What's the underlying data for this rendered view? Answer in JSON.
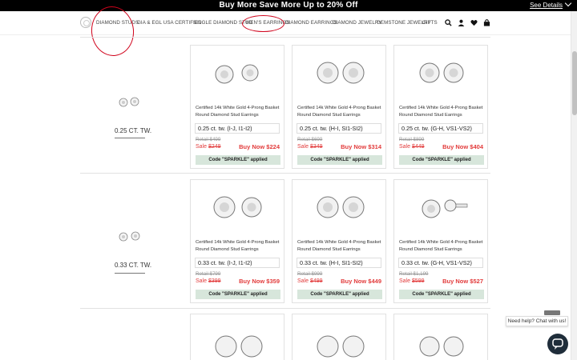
{
  "promo": {
    "text": "Buy More Save More Up to 20% Off",
    "details_label": "See Details"
  },
  "nav": {
    "items": [
      "DIAMOND STUDS",
      "GIA & EGL USA CERTIFIED",
      "SINGLE DIAMOND STUD",
      "MEN'S EARRINGS",
      "DIAMOND EARRINGS",
      "DIAMOND JEWELRY",
      "GEMSTONE JEWELRY",
      "GIFTS"
    ],
    "icons": [
      "search-icon",
      "account-icon",
      "heart-icon",
      "bag-icon"
    ]
  },
  "annotation_color": "#d0021b",
  "rows": [
    {
      "label": "0.25 CT. TW.",
      "cards": [
        {
          "title": "Certified 14k White Gold 4-Prong Basket Round Diamond Stud Earrings",
          "variant": "0.25 ct. tw. (I-J, I1-I2)",
          "retail": "Retail $499",
          "sale_prefix": "Sale",
          "sale_price": "$249",
          "buy": "Buy Now $224",
          "code": "Code \"SPARKLE\" applied"
        },
        {
          "title": "Certified 14k White Gold 4-Prong Basket Round Diamond Stud Earrings",
          "variant": "0.25 ct. tw. (H-I, SI1-SI2)",
          "retail": "Retail $699",
          "sale_prefix": "Sale",
          "sale_price": "$349",
          "buy": "Buy Now $314",
          "code": "Code \"SPARKLE\" applied"
        },
        {
          "title": "Certified 14k White Gold 4-Prong Basket Round Diamond Stud Earrings",
          "variant": "0.25 ct. tw. (G-H, VS1-VS2)",
          "retail": "Retail $899",
          "sale_prefix": "Sale",
          "sale_price": "$449",
          "buy": "Buy Now $404",
          "code": "Code \"SPARKLE\" applied"
        }
      ]
    },
    {
      "label": "0.33 CT. TW.",
      "cards": [
        {
          "title": "Certified 14k White Gold 4-Prong Basket Round Diamond Stud Earrings",
          "variant": "0.33 ct. tw. (I-J, I1-I2)",
          "retail": "Retail $799",
          "sale_prefix": "Sale",
          "sale_price": "$399",
          "buy": "Buy Now $359",
          "code": "Code \"SPARKLE\" applied"
        },
        {
          "title": "Certified 14k White Gold 4-Prong Basket Round Diamond Stud Earrings",
          "variant": "0.33 ct. tw. (H-I, SI1-SI2)",
          "retail": "Retail $999",
          "sale_prefix": "Sale",
          "sale_price": "$499",
          "buy": "Buy Now $449",
          "code": "Code \"SPARKLE\" applied"
        },
        {
          "title": "Certified 14k White Gold 4-Prong Basket Round Diamond Stud Earrings",
          "variant": "0.33 ct. tw. (G-H, VS1-VS2)",
          "retail": "Retail $1,199",
          "sale_prefix": "Sale",
          "sale_price": "$599",
          "buy": "Buy Now $527",
          "code": "Code \"SPARKLE\" applied"
        }
      ]
    }
  ],
  "chat": {
    "prompt": "Need help? Chat with us!"
  }
}
